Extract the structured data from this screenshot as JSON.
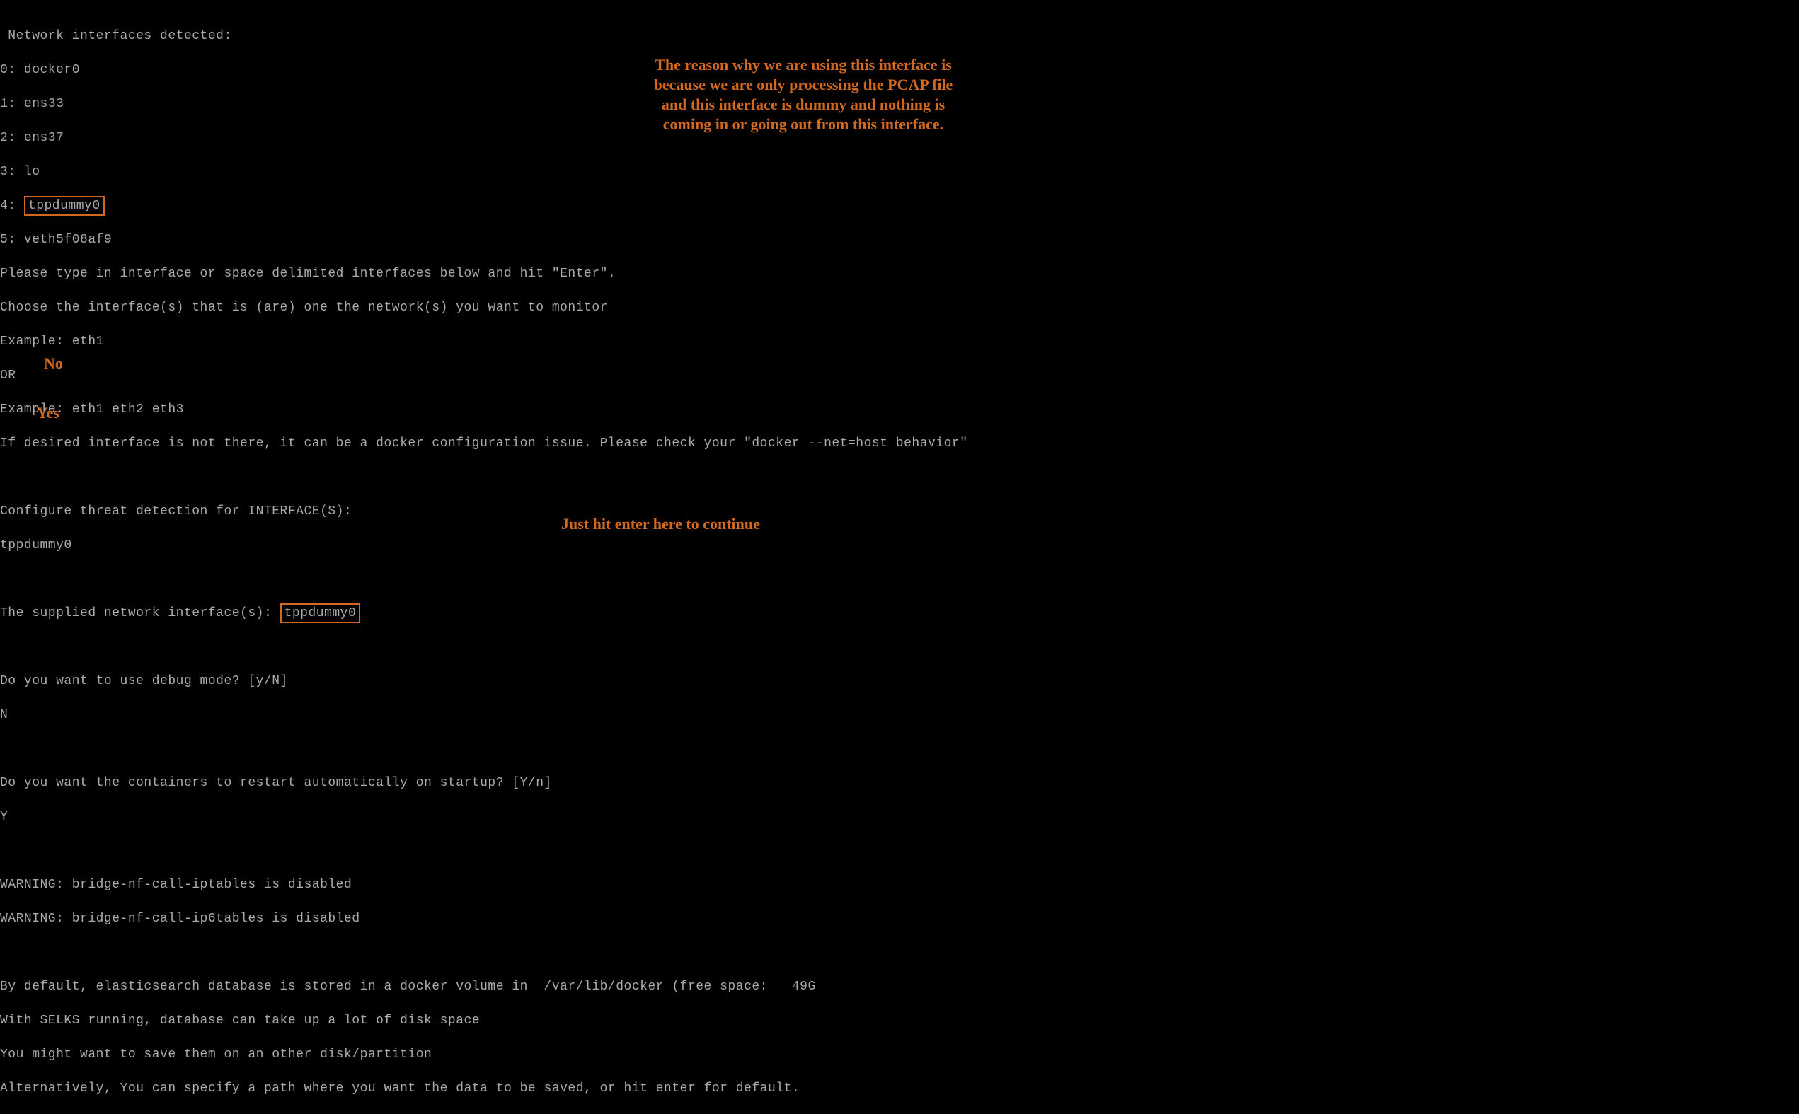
{
  "terminal": {
    "line_header": " Network interfaces detected:",
    "iface_0": "0: docker0",
    "iface_1": "1: ens33",
    "iface_2": "2: ens37",
    "iface_3": "3: lo",
    "iface_4_prefix": "4: ",
    "iface_4_value": "tppdummy0",
    "iface_5": "5: veth5f08af9",
    "prompt_1": "Please type in interface or space delimited interfaces below and hit \"Enter\".",
    "prompt_2": "Choose the interface(s) that is (are) one the network(s) you want to monitor",
    "example_1": "Example: eth1",
    "or": "OR",
    "example_2": "Example: eth1 eth2 eth3",
    "docker_note": "If desired interface is not there, it can be a docker configuration issue. Please check your \"docker --net=host behavior\"",
    "configure": "Configure threat detection for INTERFACE(S):",
    "input_iface": "tppdummy0",
    "supplied_prefix": "The supplied network interface(s): ",
    "supplied_value": "tppdummy0",
    "debug_prompt": "Do you want to use debug mode? [y/N]",
    "debug_answer": "N",
    "restart_prompt": "Do you want the containers to restart automatically on startup? [Y/n]",
    "restart_answer": "Y",
    "warn_1": "WARNING: bridge-nf-call-iptables is disabled",
    "warn_2": "WARNING: bridge-nf-call-ip6tables is disabled",
    "es_1": "By default, elasticsearch database is stored in a docker volume in  /var/lib/docker (free space:   49G",
    "es_2": "With SELKS running, database can take up a lot of disk space",
    "es_3": "You might want to save them on an other disk/partition",
    "es_4": "Alternatively, You can specify a path where you want the data to be saved, or hit enter for default."
  },
  "annotations": {
    "right": "The reason why we are using this interface is because we are only processing the PCAP file and this interface is dummy and nothing is coming in or going out from this interface.",
    "no": "No",
    "yes": "Yes",
    "enter": "Just hit enter here to continue"
  }
}
